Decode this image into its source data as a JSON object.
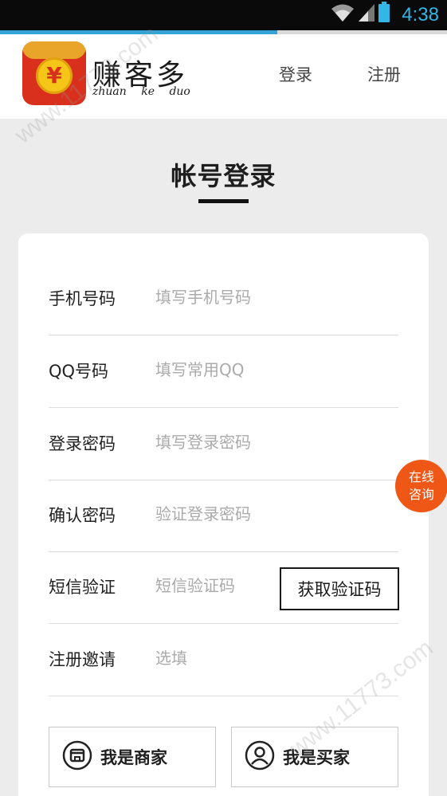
{
  "status_bar": {
    "time": "4:38",
    "icons": [
      "wifi-icon",
      "cell-signal-icon",
      "battery-icon"
    ]
  },
  "progress": {
    "fraction": 0.62,
    "color": "#33a3d6"
  },
  "header": {
    "logo_title": "赚客多",
    "logo_subtitle": "zhuan ke duo",
    "logo_symbol": "¥",
    "nav_login": "登录",
    "nav_register": "注册"
  },
  "page": {
    "title": "帐号登录"
  },
  "form": {
    "rows": [
      {
        "label": "手机号码",
        "placeholder": "填写手机号码",
        "value": ""
      },
      {
        "label": "QQ号码",
        "placeholder": "填写常用QQ",
        "value": ""
      },
      {
        "label": "登录密码",
        "placeholder": "填写登录密码",
        "value": ""
      },
      {
        "label": "确认密码",
        "placeholder": "验证登录密码",
        "value": ""
      },
      {
        "label": "短信验证",
        "placeholder": "短信验证码",
        "value": ""
      },
      {
        "label": "注册邀请",
        "placeholder": "选填",
        "value": ""
      }
    ],
    "get_code_button": "获取验证码"
  },
  "roles": {
    "merchant_label": "我是商家",
    "buyer_label": "我是买家"
  },
  "consult": {
    "line1": "在线",
    "line2": "咨询"
  },
  "watermark": {
    "text": "www.11773.com"
  },
  "colors": {
    "accent_blue": "#33b5e5",
    "consult_orange": "#ef5716",
    "logo_red": "#d9301e"
  }
}
